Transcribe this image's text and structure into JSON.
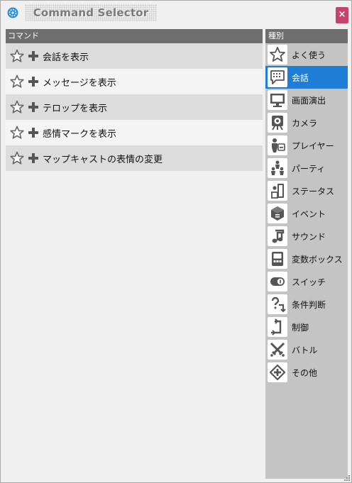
{
  "window": {
    "title": "Command Selector",
    "close_label": "×"
  },
  "commands": {
    "header": "コマンド",
    "items": [
      {
        "label": "会話を表示"
      },
      {
        "label": "メッセージを表示"
      },
      {
        "label": "テロップを表示"
      },
      {
        "label": "感情マークを表示"
      },
      {
        "label": "マップキャストの表情の変更"
      }
    ]
  },
  "categories": {
    "header": "種別",
    "selected": "会話",
    "items": [
      {
        "label": "よく使う",
        "icon": "star-icon"
      },
      {
        "label": "会話",
        "icon": "speech-bubble-icon"
      },
      {
        "label": "画面演出",
        "icon": "monitor-icon"
      },
      {
        "label": "カメラ",
        "icon": "camera-icon"
      },
      {
        "label": "プレイヤー",
        "icon": "player-icon"
      },
      {
        "label": "パーティ",
        "icon": "party-icon"
      },
      {
        "label": "ステータス",
        "icon": "status-icon"
      },
      {
        "label": "イベント",
        "icon": "event-icon"
      },
      {
        "label": "サウンド",
        "icon": "music-note-icon"
      },
      {
        "label": "変数ボックス",
        "icon": "variable-box-icon"
      },
      {
        "label": "スイッチ",
        "icon": "switch-icon"
      },
      {
        "label": "条件判断",
        "icon": "condition-icon"
      },
      {
        "label": "制御",
        "icon": "control-icon"
      },
      {
        "label": "バトル",
        "icon": "battle-icon"
      },
      {
        "label": "その他",
        "icon": "other-icon"
      }
    ]
  },
  "colors": {
    "selected": "#1e7dd6",
    "header": "#6e6e6e",
    "close": "#c7436d",
    "icon": "#555555"
  }
}
